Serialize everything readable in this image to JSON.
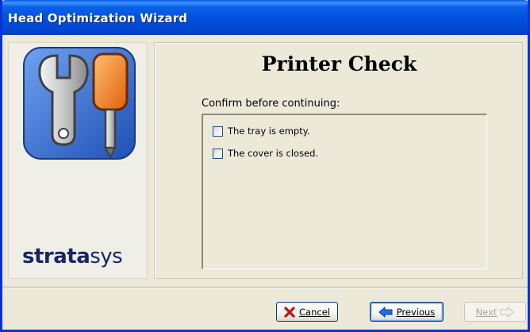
{
  "window": {
    "title": "Head Optimization Wizard"
  },
  "branding": {
    "logo_bold": "strata",
    "logo_rest": "sys",
    "icon": "wrench-screwdriver-icon"
  },
  "page": {
    "title": "Printer Check",
    "instruction": "Confirm before continuing:",
    "checks": [
      {
        "label": "The tray is empty.",
        "checked": false
      },
      {
        "label": "The cover is closed.",
        "checked": false
      }
    ]
  },
  "buttons": {
    "cancel": {
      "label": "Cancel",
      "icon": "red-x-icon"
    },
    "previous": {
      "label": "Previous",
      "icon": "back-arrow-icon"
    },
    "next": {
      "label": "Next",
      "icon": "forward-arrow-icon",
      "enabled": false
    }
  },
  "colors": {
    "titlebar": "#0054e3",
    "brand": "#152766",
    "screwdriver": "#f07d18",
    "wrench_tile": "#3c74d6"
  }
}
